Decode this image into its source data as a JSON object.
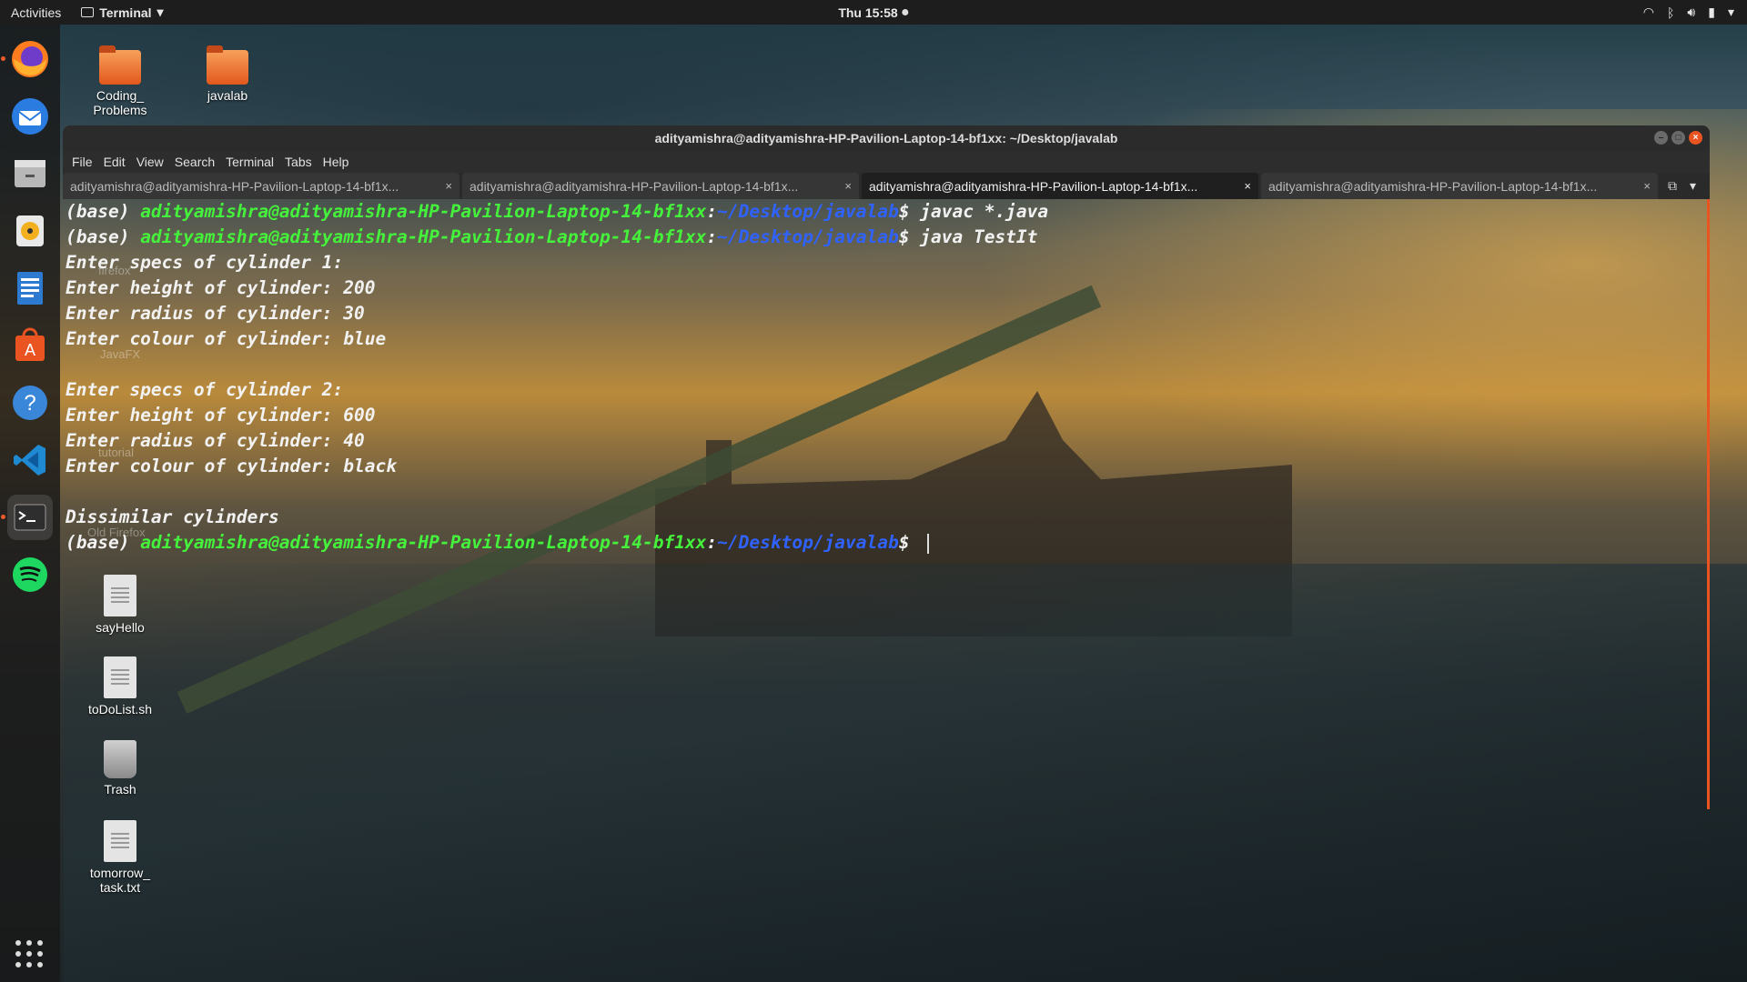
{
  "topbar": {
    "activities": "Activities",
    "app_menu": "Terminal",
    "clock": "Thu 15:58"
  },
  "dock": {
    "apps": [
      "firefox",
      "thunderbird",
      "files",
      "rhythmbox",
      "libreoffice-writer",
      "ubuntu-software",
      "help",
      "vscode",
      "terminal",
      "spotify"
    ],
    "show_apps_label": "Show Applications"
  },
  "desktop": {
    "icons": [
      {
        "label": "Coding_\nProblems",
        "type": "folder"
      },
      {
        "label": "javalab",
        "type": "folder"
      },
      {
        "label": "sayHello",
        "type": "file"
      },
      {
        "label": "toDoList.sh",
        "type": "file"
      },
      {
        "label": "Trash",
        "type": "trash"
      },
      {
        "label": "tomorrow_\ntask.txt",
        "type": "file"
      }
    ],
    "hidden_labels": [
      "firefox",
      "JavaFX",
      "tutorial",
      "Old Firefox"
    ]
  },
  "window": {
    "title": "adityamishra@adityamishra-HP-Pavilion-Laptop-14-bf1xx: ~/Desktop/javalab",
    "menu": [
      "File",
      "Edit",
      "View",
      "Search",
      "Terminal",
      "Tabs",
      "Help"
    ],
    "tabs": [
      {
        "label": "adityamishra@adityamishra-HP-Pavilion-Laptop-14-bf1x...",
        "active": false
      },
      {
        "label": "adityamishra@adityamishra-HP-Pavilion-Laptop-14-bf1x...",
        "active": false
      },
      {
        "label": "adityamishra@adityamishra-HP-Pavilion-Laptop-14-bf1x...",
        "active": true
      },
      {
        "label": "adityamishra@adityamishra-HP-Pavilion-Laptop-14-bf1x...",
        "active": false
      }
    ]
  },
  "terminal": {
    "prompt_base": "(base) ",
    "prompt_user": "adityamishra@adityamishra-HP-Pavilion-Laptop-14-bf1xx",
    "prompt_sep": ":",
    "prompt_path": "~/Desktop/javalab",
    "prompt_end": "$ ",
    "cmd1": "javac *.java",
    "cmd2": "java TestIt",
    "out": [
      "Enter specs of cylinder 1:",
      "Enter height of cylinder: 200",
      "Enter radius of cylinder: 30",
      "Enter colour of cylinder: blue",
      "",
      "Enter specs of cylinder 2:",
      "Enter height of cylinder: 600",
      "Enter radius of cylinder: 40",
      "Enter colour of cylinder: black",
      "",
      "Dissimilar cylinders"
    ]
  },
  "colors": {
    "accent": "#e95420",
    "prompt_user": "#45f23b",
    "prompt_path": "#2f62ff"
  }
}
